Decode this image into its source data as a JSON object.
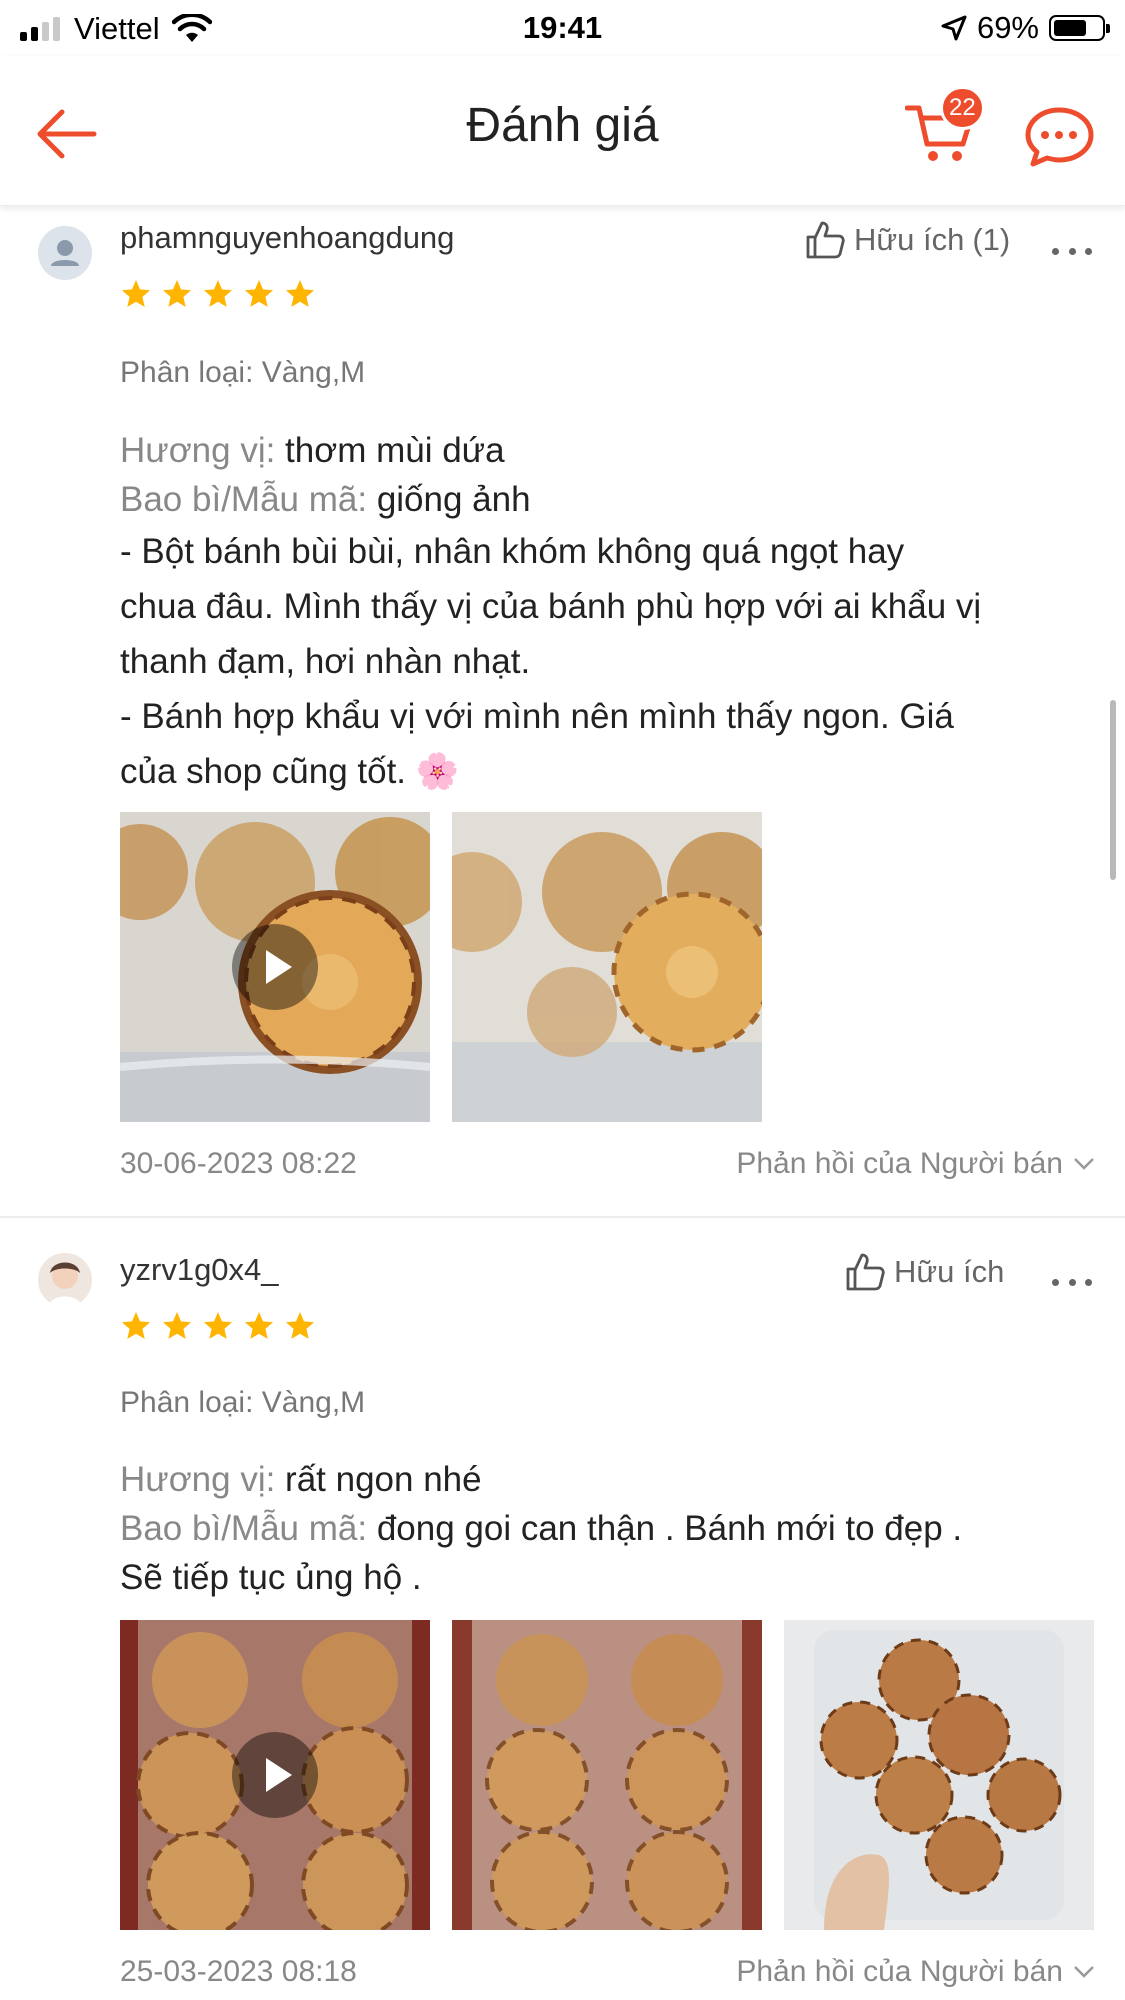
{
  "status_bar": {
    "carrier": "Viettel",
    "time": "19:41",
    "battery_percent": "69%",
    "battery_level": 0.69,
    "signal_bars_active": 2
  },
  "header": {
    "title": "Đánh giá",
    "cart_badge": "22",
    "icons": {
      "back": "arrow-left-icon",
      "cart": "cart-icon",
      "chat": "chat-bubble-icon"
    }
  },
  "colors": {
    "accent": "#ee4d2d",
    "star": "#ffb400",
    "muted_text": "#888888"
  },
  "reviews": [
    {
      "username": "phamnguyenhoangdung",
      "helpful_label": "Hữu ích",
      "helpful_count": "(1)",
      "rating": 5,
      "variation": "Phân loại: Vàng,M",
      "taste_label": "Hương vị:",
      "taste_value": "thơm mùi dứa",
      "packaging_label": "Bao bì/Mẫu mã:",
      "packaging_value": "giống ảnh",
      "body_lines": [
        "- Bột bánh bùi bùi, nhân khóm không quá ngọt hay",
        "chua đâu. Mình thấy vị của bánh phù hợp với ai khẩu vị",
        "thanh đạm, hơi nhàn nhạt.",
        "- Bánh hợp khẩu vị với mình nên mình thấy ngon. Giá",
        "của shop cũng tốt. 🌸"
      ],
      "media": [
        {
          "type": "video"
        },
        {
          "type": "photo"
        }
      ],
      "date": "30-06-2023 08:22",
      "seller_reply_label": "Phản hồi của Người bán"
    },
    {
      "username": "yzrv1g0x4_",
      "helpful_label": "Hữu ích",
      "helpful_count": "",
      "rating": 5,
      "variation": "Phân loại: Vàng,M",
      "taste_label": "Hương vị:",
      "taste_value": "rất ngon nhé",
      "packaging_label": "Bao bì/Mẫu mã:",
      "packaging_value": "đong goi can thận . Bánh mới to đẹp .",
      "body_lines": [
        "Sẽ tiếp tục ủng hộ ."
      ],
      "media": [
        {
          "type": "video"
        },
        {
          "type": "photo"
        },
        {
          "type": "photo"
        }
      ],
      "date": "25-03-2023 08:18",
      "seller_reply_label": "Phản hồi của Người bán"
    }
  ]
}
